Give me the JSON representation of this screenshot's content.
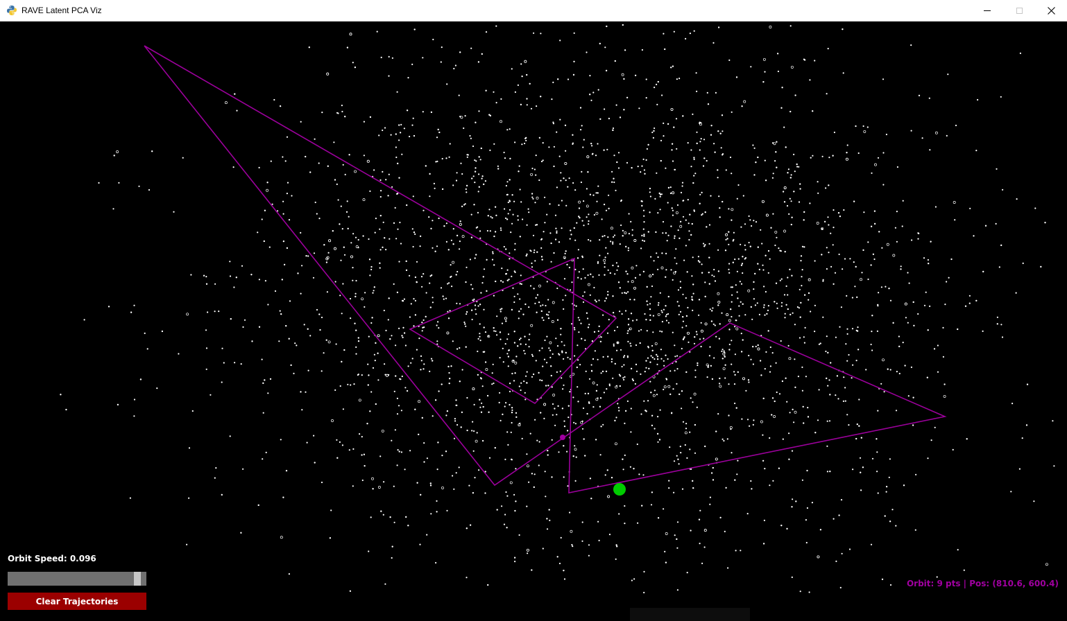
{
  "window": {
    "title": "RAVE Latent PCA Viz",
    "app_icon": "python-icon",
    "controls": [
      "minimize-icon",
      "maximize-icon",
      "close-icon"
    ]
  },
  "colors": {
    "background": "#000000",
    "points": "#ffffff",
    "trajectory": "#9b009b",
    "orbit_marker": "#00cc00",
    "cursor_point": "#a000a0",
    "slider_track": "#707070",
    "slider_handle": "#c8c8c8",
    "clear_button": "#9b0000",
    "status_text": "#a000a0"
  },
  "controls": {
    "orbit_speed_label": "Orbit Speed: 0.096",
    "orbit_speed_value": 0.096,
    "slider_fraction": 0.96,
    "clear_button_label": "Clear Trajectories"
  },
  "status": {
    "text": "Orbit: 9 pts | Pos: (810.6, 600.4)"
  }
}
